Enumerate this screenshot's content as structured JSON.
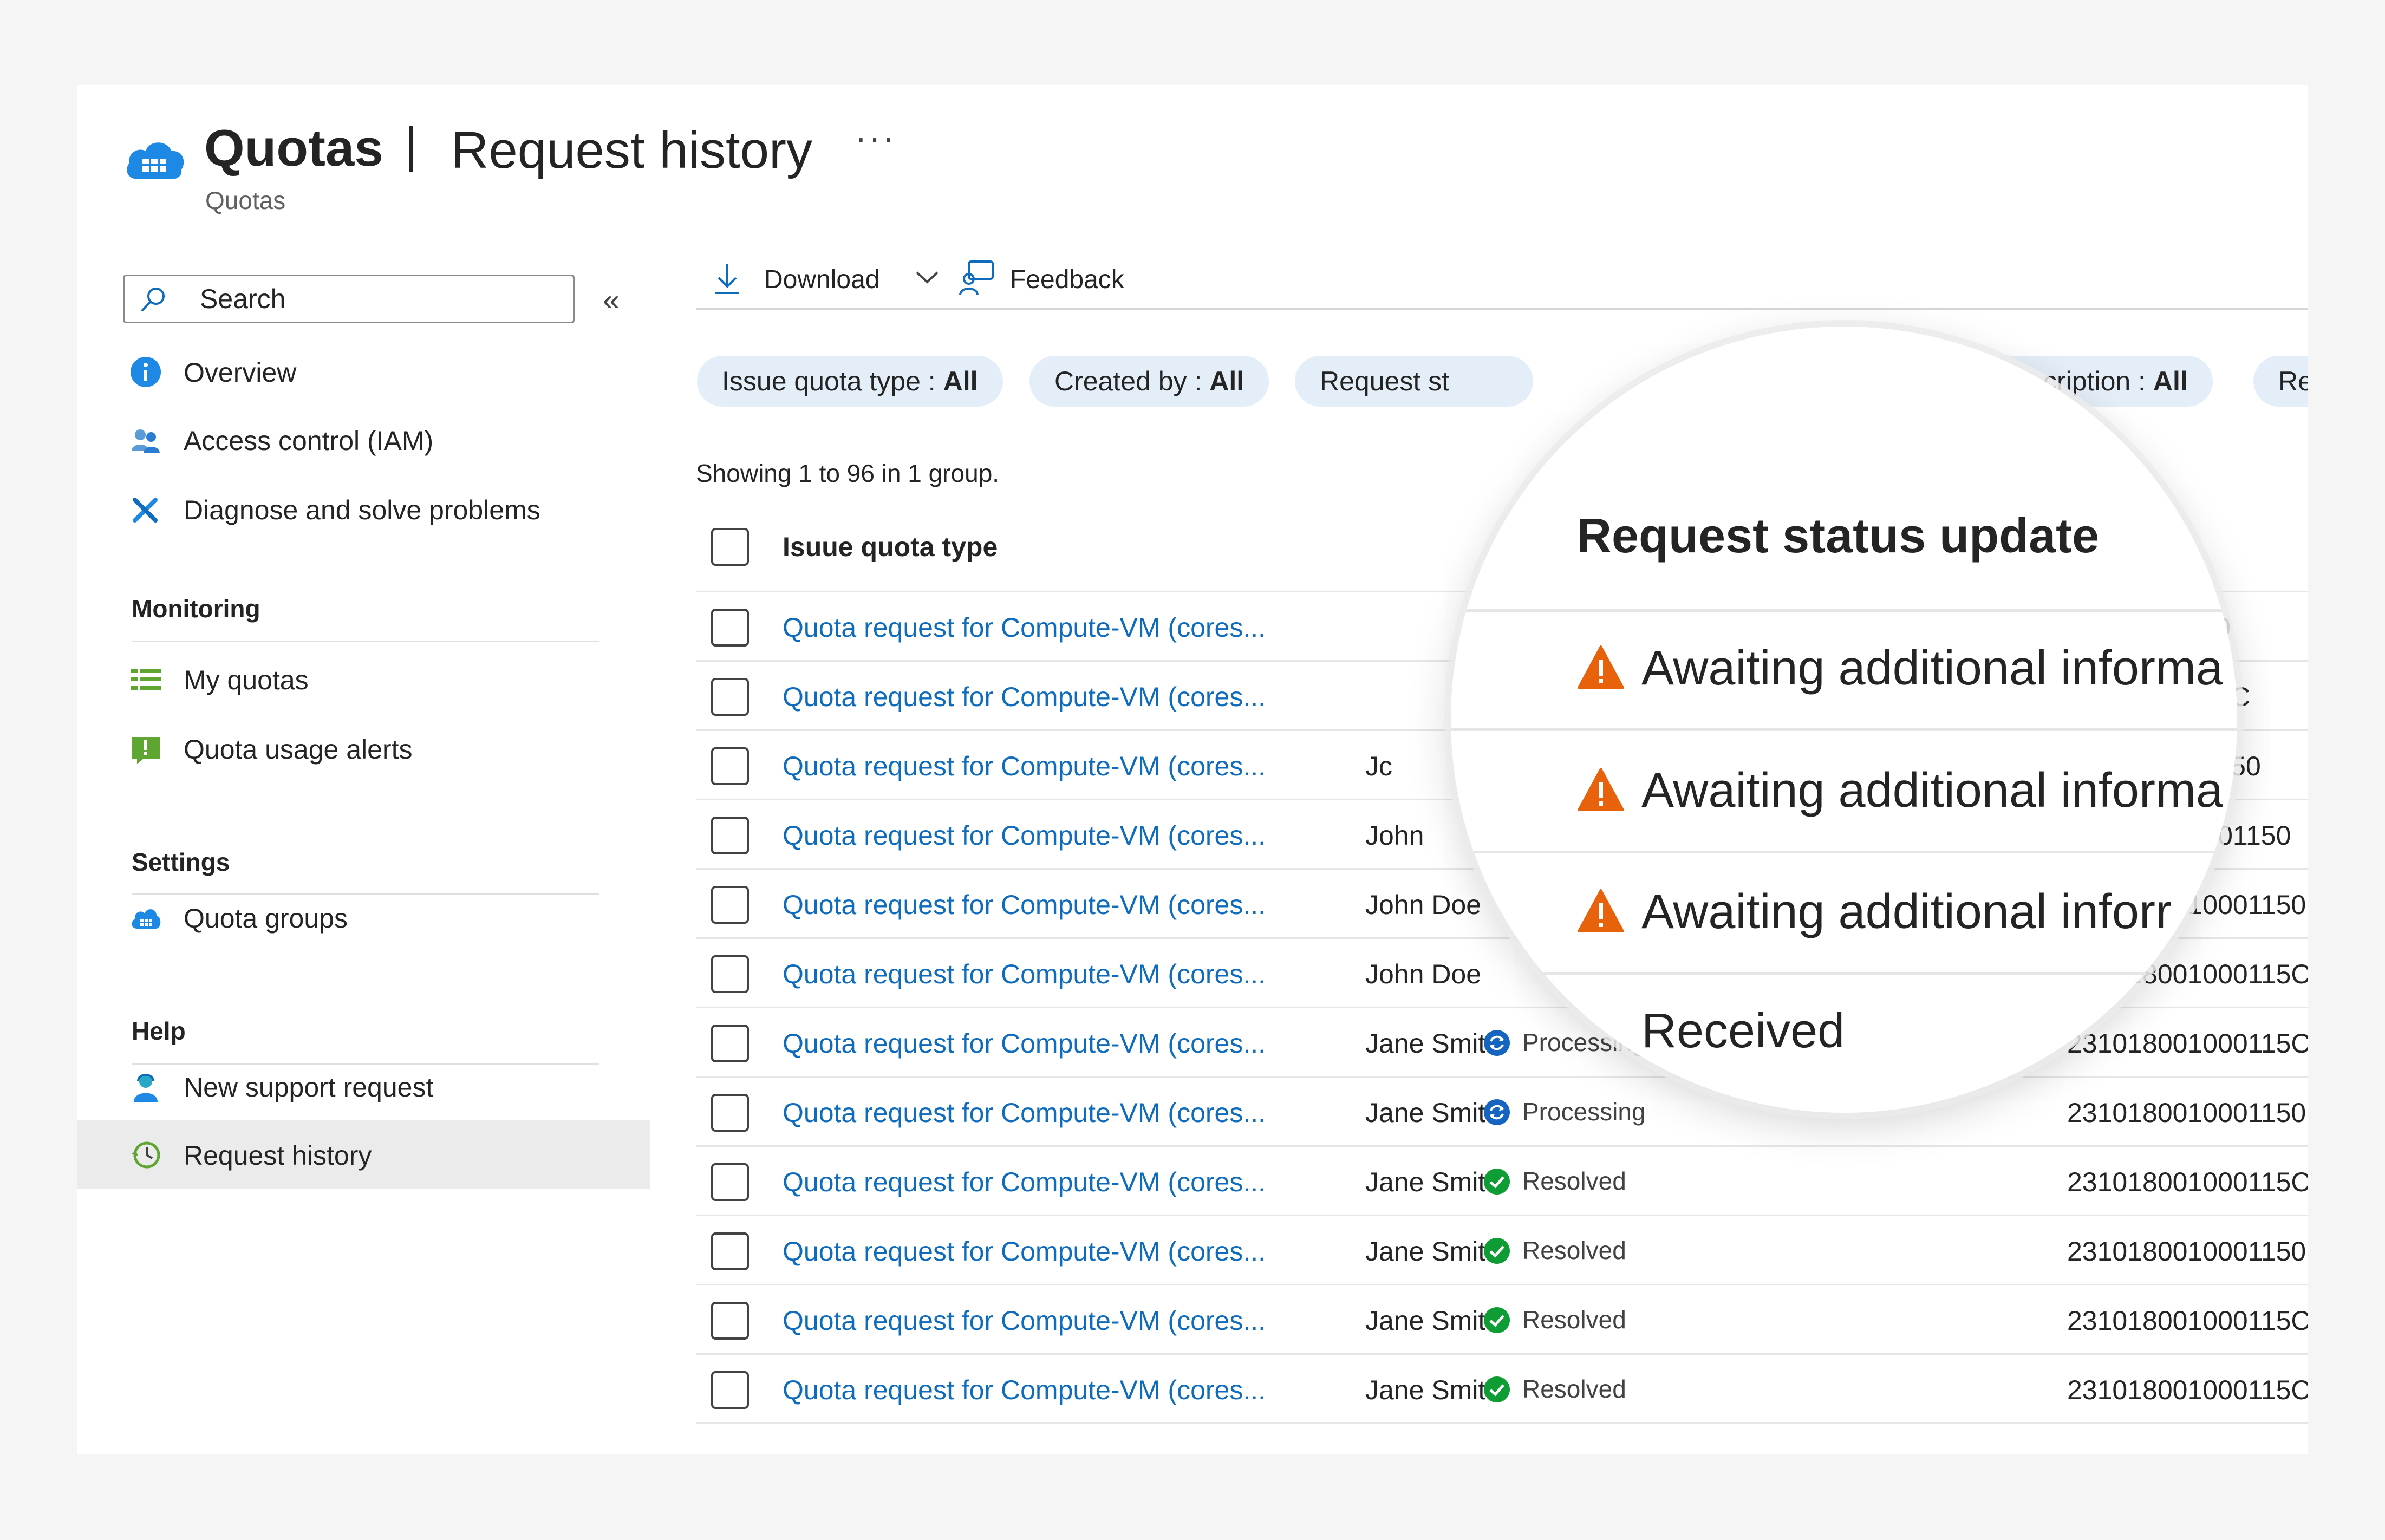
{
  "header": {
    "title": "Quotas",
    "subtitle": "Request history",
    "more": "···",
    "breadcrumb": "Quotas"
  },
  "sidebar": {
    "search_placeholder": "Search",
    "collapse": "«",
    "items_top": [
      {
        "label": "Overview",
        "icon": "info-icon"
      },
      {
        "label": "Access control (IAM)",
        "icon": "people-icon"
      },
      {
        "label": "Diagnose and solve problems",
        "icon": "wrench-icon"
      }
    ],
    "sections": [
      {
        "title": "Monitoring",
        "items": [
          {
            "label": "My quotas",
            "icon": "list-icon"
          },
          {
            "label": "Quota usage alerts",
            "icon": "alert-icon"
          }
        ]
      },
      {
        "title": "Settings",
        "items": [
          {
            "label": "Quota groups",
            "icon": "cloud-grid-icon"
          }
        ]
      },
      {
        "title": "Help",
        "items": [
          {
            "label": "New support request",
            "icon": "support-person-icon"
          },
          {
            "label": "Request history",
            "icon": "history-clock-icon",
            "selected": true
          }
        ]
      }
    ]
  },
  "toolbar": {
    "download": "Download",
    "feedback": "Feedback"
  },
  "filters": [
    {
      "label": "Issue quota type : ",
      "value": "All"
    },
    {
      "label": "Created by : ",
      "value": "All"
    },
    {
      "label": "Request st",
      "value": ""
    },
    {
      "label": "cription : ",
      "value": "All"
    },
    {
      "label": "Re",
      "value": ""
    }
  ],
  "showing": "Showing 1 to 96 in 1 group.",
  "table": {
    "header": "Isuue quota type",
    "rows": [
      {
        "name": "Quota request for Compute-VM (cores...",
        "by": "",
        "status": "",
        "id": "80010001150"
      },
      {
        "name": "Quota request for Compute-VM (cores...",
        "by": "",
        "status": "",
        "id": "18001000115C"
      },
      {
        "name": "Quota request for Compute-VM (cores...",
        "by": "Jc",
        "status": "",
        "id": "0180010001150"
      },
      {
        "name": "Quota request for Compute-VM (cores...",
        "by": "John",
        "status": "",
        "id": "310180010001150"
      },
      {
        "name": "Quota request for Compute-VM (cores...",
        "by": "John Doe",
        "status": "",
        "id": "2310180010001150"
      },
      {
        "name": "Quota request for Compute-VM (cores...",
        "by": "John Doe",
        "status": "",
        "id": "231018001000115C"
      },
      {
        "name": "Quota request for Compute-VM (cores...",
        "by": "Jane Smith",
        "status": "Processing",
        "status_icon": "processing-icon",
        "id": "231018001000115C"
      },
      {
        "name": "Quota request for Compute-VM (cores...",
        "by": "Jane Smith",
        "status": "Processing",
        "status_icon": "processing-icon",
        "id": "2310180010001150"
      },
      {
        "name": "Quota request for Compute-VM (cores...",
        "by": "Jane Smith",
        "status": "Resolved",
        "status_icon": "resolved-icon",
        "id": "231018001000115C"
      },
      {
        "name": "Quota request for Compute-VM (cores...",
        "by": "Jane Smith",
        "status": "Resolved",
        "status_icon": "resolved-icon",
        "id": "2310180010001150"
      },
      {
        "name": "Quota request for Compute-VM (cores...",
        "by": "Jane Smith",
        "status": "Resolved",
        "status_icon": "resolved-icon",
        "id": "231018001000115C"
      },
      {
        "name": "Quota request for Compute-VM (cores...",
        "by": "Jane Smith",
        "status": "Resolved",
        "status_icon": "resolved-icon",
        "id": "231018001000115C"
      }
    ]
  },
  "magnifier": {
    "title": "Request status update",
    "rows": [
      {
        "label": "Awaiting additional informa",
        "icon": "warning-icon"
      },
      {
        "label": "Awaiting additional informa",
        "icon": "warning-icon"
      },
      {
        "label": "Awaiting additional inforr",
        "icon": "warning-icon"
      },
      {
        "label": "Received",
        "icon": ""
      }
    ]
  },
  "colors": {
    "link": "#0f6cbd",
    "pill_bg": "#e4eef8",
    "warning": "#e8620c",
    "resolved": "#0e9c35",
    "processing": "#1565c0",
    "selected_nav": "#ebebeb"
  }
}
